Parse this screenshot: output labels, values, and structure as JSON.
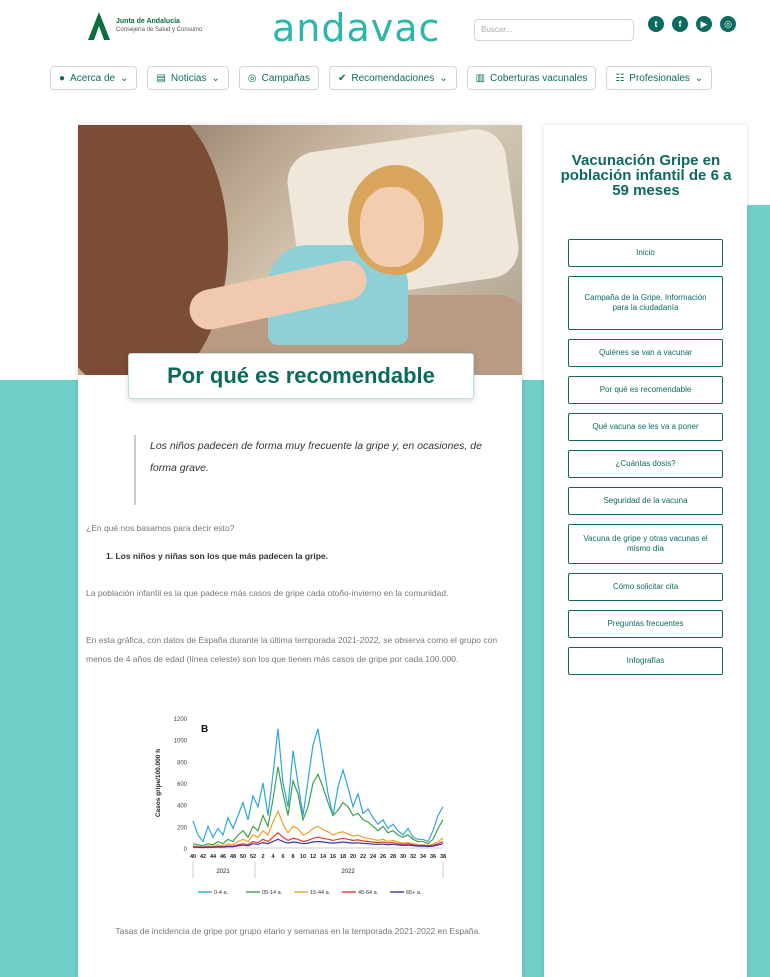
{
  "header": {
    "junta_title": "Junta de Andalucía",
    "junta_subtitle": "Consejería de Salud y Consumo",
    "brand": "andavac",
    "search_placeholder": "Buscar...",
    "socials": [
      "twitter-icon",
      "facebook-icon",
      "youtube-icon",
      "instagram-icon"
    ]
  },
  "nav": [
    {
      "label": "Acerca de",
      "icon": "info-icon",
      "dropdown": true
    },
    {
      "label": "Noticias",
      "icon": "newspaper-icon",
      "dropdown": true
    },
    {
      "label": "Campañas",
      "icon": "target-icon",
      "dropdown": false
    },
    {
      "label": "Recomendaciones",
      "icon": "check-icon",
      "dropdown": true
    },
    {
      "label": "Coberturas vacunales",
      "icon": "chart-icon",
      "dropdown": false
    },
    {
      "label": "Profesionales",
      "icon": "people-icon",
      "dropdown": true
    }
  ],
  "article": {
    "title": "Por qué es recomendable",
    "quote": "Los niños padecen de forma muy frecuente la gripe y, en ocasiones, de forma grave.",
    "p1": "¿En qué nos basamos para decir esto?",
    "li1": "1. Los niños y niñas son los que más padecen la gripe.",
    "p2": "La población infantil es la que padece más casos de gripe cada otoño-invierno en la comunidad.",
    "p3": "En esta gráfica, con datos de España durante la última temporada 2021-2022, se observa como el grupo con menos de 4 años de edad (línea celeste) son los que tienen más casos de gripe por cada 100.000.",
    "caption": "Tasas de incidencia de gripe por grupo etario y semanas en la temporada 2021-2022 en España."
  },
  "sidebar": {
    "title": "Vacunación Gripe en población infantil de 6 a 59 meses",
    "items": [
      "Inicio",
      "Campaña de la Gripe. Información para la ciudadanía",
      "Quiénes se van a vacunar",
      "Por qué es recomendable",
      "Qué vacuna se les va a poner",
      "¿Cuántas dosis?",
      "Seguridad de la vacuna",
      "Vacuna de gripe y otras vacunas el mismo día",
      "Cómo solicitar cita",
      "Preguntas frecuentes",
      "Infografías"
    ]
  },
  "colors": {
    "brand": "#0c6a5f",
    "accent": "#6fcfc9",
    "logo": "#2cb5a8"
  },
  "chart_data": {
    "type": "line",
    "panel_label": "B",
    "ylabel": "Casos gripe/100.000 h",
    "ylim": [
      0,
      1200
    ],
    "yticks": [
      0,
      200,
      400,
      600,
      800,
      1000,
      1200
    ],
    "x": [
      "40",
      "41",
      "42",
      "43",
      "44",
      "45",
      "46",
      "47",
      "48",
      "49",
      "50",
      "51",
      "52",
      "1",
      "2",
      "3",
      "4",
      "5",
      "6",
      "7",
      "8",
      "9",
      "10",
      "11",
      "12",
      "13",
      "14",
      "15",
      "16",
      "17",
      "18",
      "19",
      "20",
      "21",
      "22",
      "23",
      "24",
      "25",
      "26",
      "27",
      "28",
      "29",
      "30",
      "31",
      "32",
      "33",
      "34",
      "35",
      "36",
      "37",
      "38"
    ],
    "xticks": [
      "40",
      "42",
      "44",
      "46",
      "48",
      "50",
      "52",
      "2",
      "4",
      "6",
      "8",
      "10",
      "12",
      "14",
      "16",
      "18",
      "20",
      "22",
      "24",
      "26",
      "28",
      "30",
      "32",
      "34",
      "36",
      "38"
    ],
    "season_labels": [
      "2021",
      "2022"
    ],
    "series": [
      {
        "name": "0-4 a.",
        "color": "#2ba6d9",
        "values": [
          250,
          120,
          60,
          200,
          100,
          180,
          120,
          280,
          180,
          300,
          420,
          260,
          480,
          380,
          600,
          300,
          680,
          1100,
          600,
          380,
          900,
          600,
          300,
          620,
          950,
          1100,
          800,
          500,
          300,
          560,
          720,
          560,
          380,
          500,
          320,
          360,
          280,
          220,
          260,
          180,
          220,
          160,
          120,
          180,
          100,
          80,
          80,
          60,
          160,
          300,
          380
        ]
      },
      {
        "name": "05-14 a.",
        "color": "#3aa14b",
        "values": [
          40,
          30,
          20,
          40,
          30,
          60,
          40,
          80,
          60,
          120,
          160,
          100,
          200,
          160,
          300,
          200,
          450,
          750,
          500,
          300,
          620,
          500,
          260,
          380,
          600,
          680,
          560,
          420,
          300,
          350,
          420,
          380,
          300,
          320,
          260,
          240,
          200,
          160,
          200,
          140,
          160,
          120,
          100,
          120,
          80,
          60,
          60,
          40,
          80,
          180,
          260
        ]
      },
      {
        "name": "15-44 a.",
        "color": "#f0a02b",
        "values": [
          20,
          15,
          10,
          20,
          15,
          30,
          20,
          40,
          30,
          60,
          80,
          60,
          120,
          100,
          160,
          120,
          240,
          340,
          220,
          140,
          200,
          180,
          120,
          140,
          180,
          200,
          170,
          150,
          120,
          140,
          150,
          130,
          110,
          120,
          100,
          90,
          80,
          70,
          80,
          60,
          70,
          55,
          45,
          50,
          40,
          30,
          30,
          25,
          35,
          60,
          90
        ]
      },
      {
        "name": "45-64 a.",
        "color": "#e03a2f",
        "values": [
          10,
          8,
          6,
          10,
          8,
          14,
          10,
          20,
          16,
          30,
          40,
          30,
          60,
          50,
          80,
          60,
          100,
          140,
          100,
          70,
          90,
          80,
          60,
          70,
          90,
          100,
          90,
          80,
          70,
          80,
          90,
          80,
          70,
          75,
          65,
          60,
          55,
          50,
          55,
          45,
          50,
          40,
          35,
          38,
          30,
          25,
          25,
          20,
          25,
          40,
          60
        ]
      },
      {
        "name": "65+ a.",
        "color": "#3b34a8",
        "values": [
          8,
          6,
          5,
          8,
          6,
          10,
          8,
          14,
          12,
          20,
          26,
          20,
          40,
          34,
          50,
          40,
          60,
          80,
          60,
          45,
          55,
          50,
          40,
          45,
          55,
          60,
          55,
          50,
          45,
          50,
          55,
          50,
          45,
          48,
          42,
          40,
          36,
          34,
          36,
          30,
          34,
          28,
          24,
          26,
          22,
          18,
          18,
          14,
          18,
          28,
          40
        ]
      }
    ]
  }
}
